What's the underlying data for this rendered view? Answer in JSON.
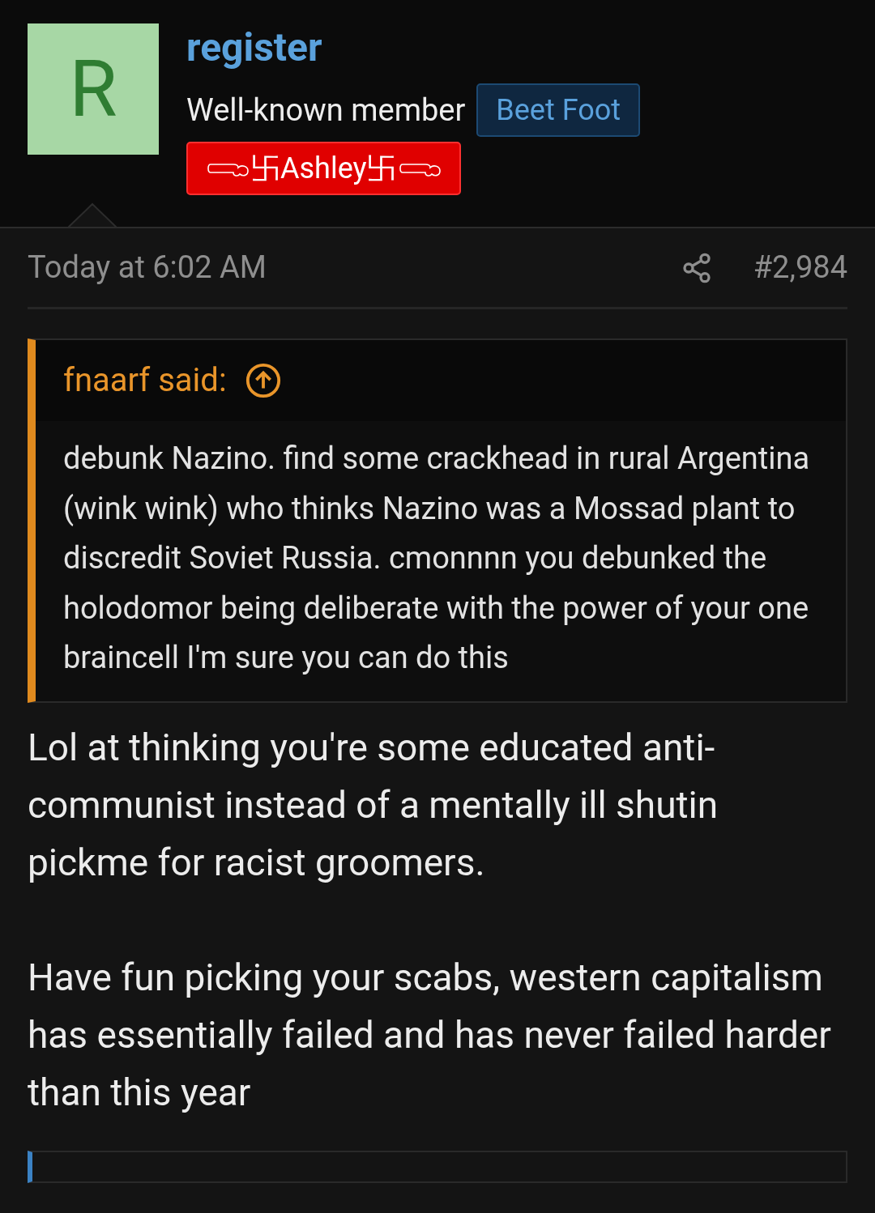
{
  "author": {
    "avatar_letter": "R",
    "name": "register",
    "title": "Well-known member",
    "badge": "Beet Foot",
    "banner": "卐Ashley卐"
  },
  "post": {
    "time": "Today at 6:02 AM",
    "number": "#2,984",
    "quote": {
      "header": "fnaarf said:",
      "text": "debunk Nazino. find some crackhead in rural Argentina (wink wink) who thinks Nazino was a Mossad plant to discredit Soviet Russia. cmonnnn you debunked the holodomor being deliberate with the power of your one braincell I'm sure you can do this"
    },
    "paragraphs": [
      "Lol at thinking you're some educated anti-communist instead of a mentally ill shutin pickme for racist groomers.",
      "Have fun picking your scabs, western capitalism has essentially failed and has never failed harder than this year"
    ]
  }
}
